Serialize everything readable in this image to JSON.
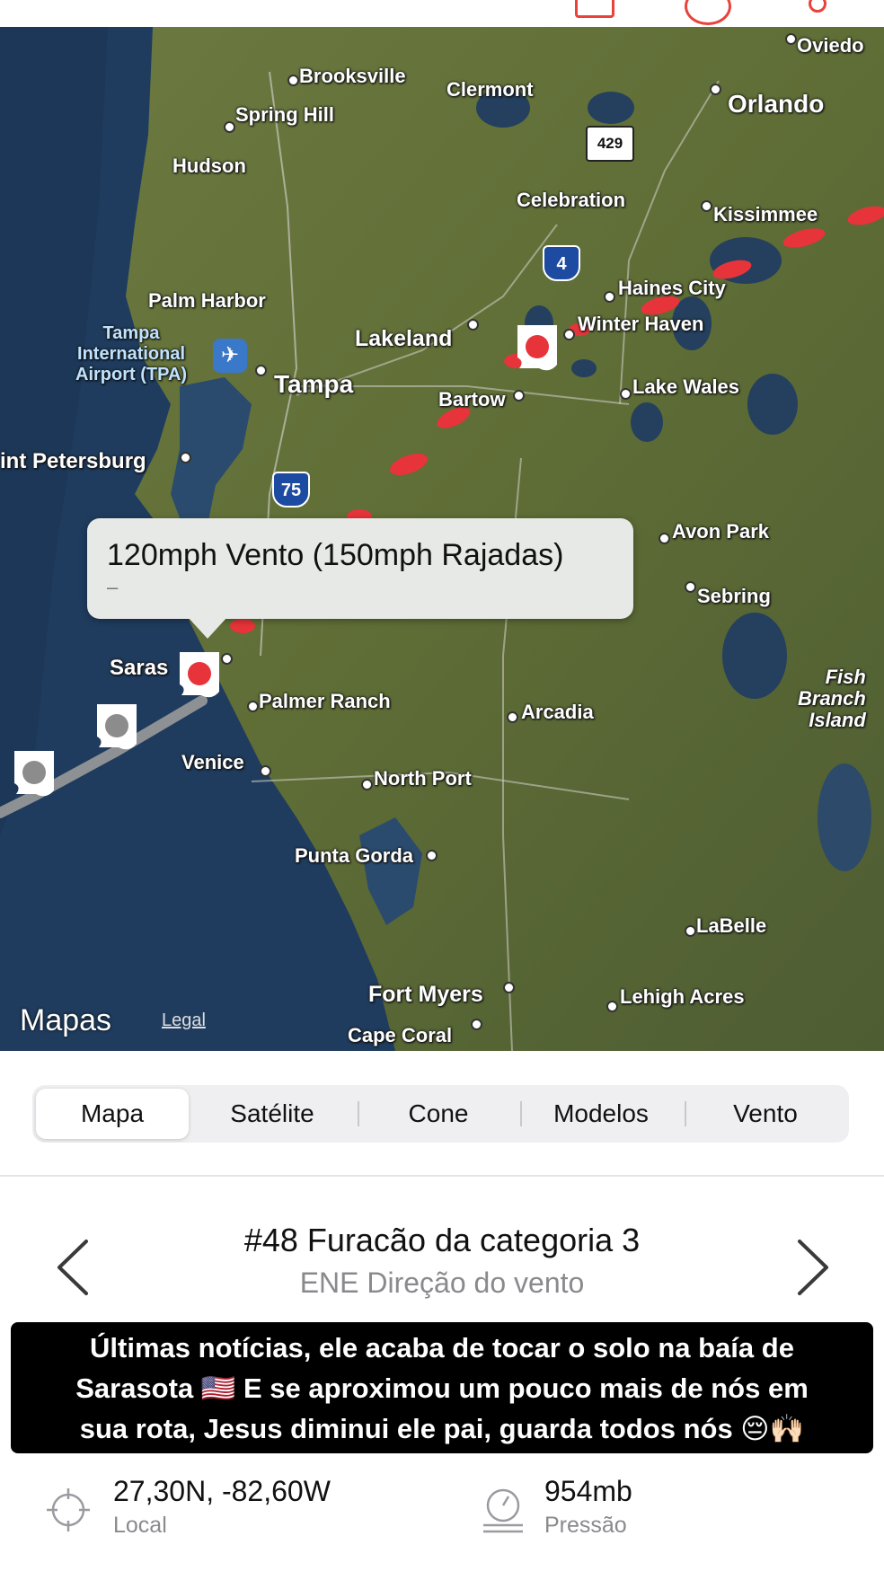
{
  "map": {
    "cities": [
      {
        "name": "Oviedo"
      },
      {
        "name": "Brooksville"
      },
      {
        "name": "Clermont"
      },
      {
        "name": "Orlando"
      },
      {
        "name": "Spring Hill"
      },
      {
        "name": "Hudson"
      },
      {
        "name": "Celebration"
      },
      {
        "name": "Kissimmee"
      },
      {
        "name": "Haines City"
      },
      {
        "name": "Palm Harbor"
      },
      {
        "name": "Lakeland"
      },
      {
        "name": "Winter Haven"
      },
      {
        "name": "Tampa"
      },
      {
        "name": "Bartow"
      },
      {
        "name": "Lake Wales"
      },
      {
        "name": "int Petersburg"
      },
      {
        "name": "Avon Park"
      },
      {
        "name": "Sebring"
      },
      {
        "name": "Saras"
      },
      {
        "name": "Palmer Ranch"
      },
      {
        "name": "Arcadia"
      },
      {
        "name": "Venice"
      },
      {
        "name": "North Port"
      },
      {
        "name": "Punta Gorda"
      },
      {
        "name": "LaBelle"
      },
      {
        "name": "Fort Myers"
      },
      {
        "name": "Lehigh Acres"
      },
      {
        "name": "Cape Coral"
      }
    ],
    "airport": [
      "Tampa",
      "International",
      "Airport (TPA)"
    ],
    "island": [
      "Fish",
      "Branch",
      "Island"
    ],
    "shields": [
      "429",
      "4",
      "75"
    ],
    "callout": {
      "title": "120mph Vento (150mph Rajadas)",
      "subtitle": "–"
    },
    "attribution": {
      "logo": "Mapas",
      "legal": "Legal"
    }
  },
  "segments": [
    "Mapa",
    "Satélite",
    "Cone",
    "Modelos",
    "Vento"
  ],
  "segments_selected": "Mapa",
  "storm": {
    "title": "#48 Furacão da categoria 3",
    "subtitle": "ENE Direção do vento"
  },
  "caption": {
    "lines": [
      "Últimas notícias, ele acaba de tocar o solo na baía de",
      "Sarasota 🇺🇸 E se aproximou um pouco mais de nós em",
      "sua rota, Jesus diminui ele pai, guarda todos nós 😔🙌🏻"
    ]
  },
  "info": {
    "location": {
      "value": "27,30N, -82,60W",
      "label": "Local"
    },
    "pressure": {
      "value": "954mb",
      "label": "Pressão"
    }
  },
  "colors": {
    "accent": "#e8423a",
    "land": "#6b7a3e",
    "water": "#1f3c5e",
    "storm_active": "#e6343a",
    "storm_past": "#8c8c8c"
  }
}
